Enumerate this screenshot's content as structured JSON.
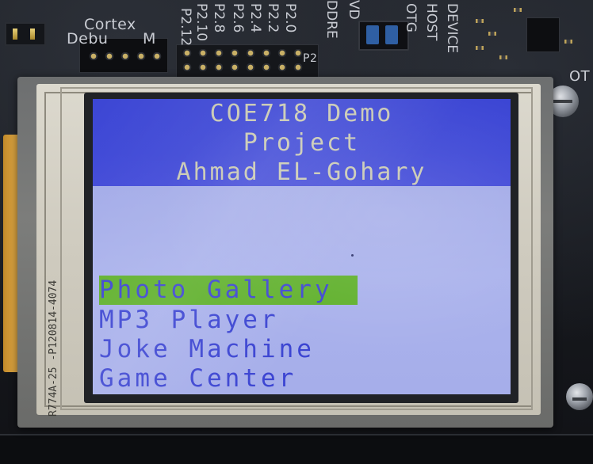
{
  "board": {
    "silkscreen": {
      "cortex_label": "Cortex",
      "debug_label": "Debu",
      "debug_label_suffix": "M",
      "p2_row_a": [
        "P2.10",
        "P2.8",
        "P2.6",
        "P2.4",
        "P2.2",
        "P2.0"
      ],
      "p2_row_b": [
        "P2.12"
      ],
      "p2_header_label": "P2",
      "usb_host": "HOST",
      "usb_otg": "OTG",
      "usb_device": "DEVICE",
      "vdd_label": "VD",
      "address_label": "DDRE",
      "corner_label": "OT"
    }
  },
  "lcd": {
    "flex_label": "R774A-25 -P120814-4074"
  },
  "screen": {
    "title_lines": [
      "COE718 Demo",
      "Project",
      "Ahmad EL-Gohary"
    ],
    "menu": [
      {
        "label": "Photo Gallery",
        "selected": true
      },
      {
        "label": "MP3 Player",
        "selected": false
      },
      {
        "label": "Joke Machine",
        "selected": false
      },
      {
        "label": "Game Center",
        "selected": false
      }
    ]
  },
  "colors": {
    "title_background": "#3d47d6",
    "title_text": "#c8c8b2",
    "screen_background": "#a5ade9",
    "menu_text": "#3c45d2",
    "selection_highlight": "#5fb02b"
  }
}
